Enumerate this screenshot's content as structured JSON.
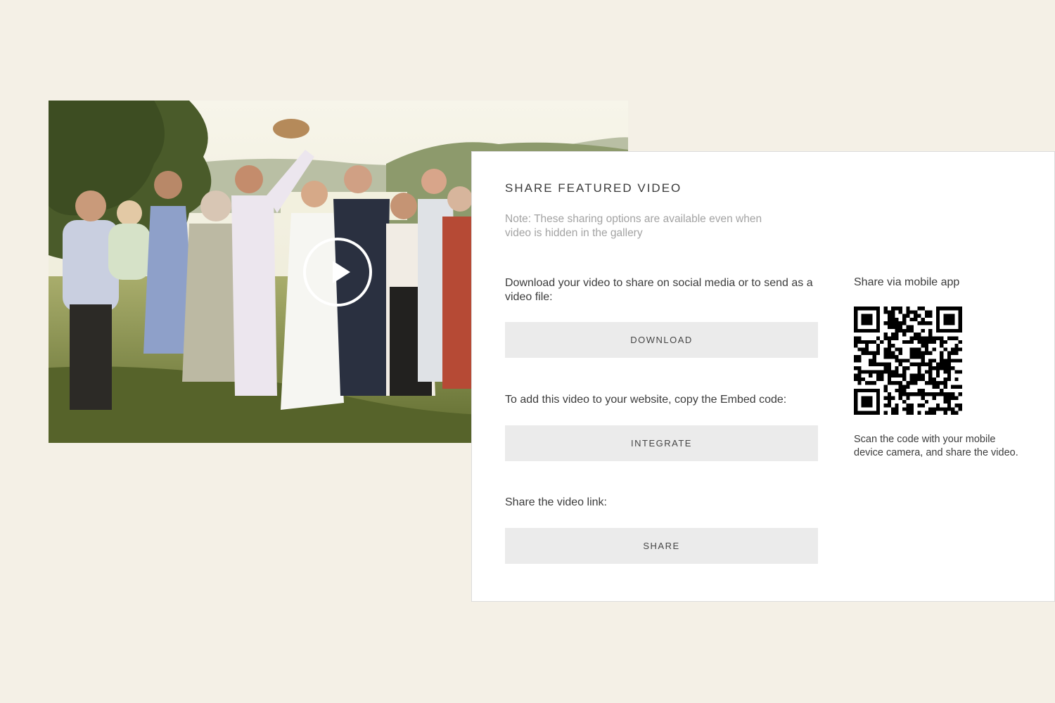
{
  "video": {
    "play_icon": "play-icon"
  },
  "share_panel": {
    "title": "SHARE FEATURED VIDEO",
    "note": "Note: These sharing options are available even when video is hidden in the gallery",
    "download": {
      "description": "Download your video to share on social media or to send as a video file:",
      "button_label": "DOWNLOAD"
    },
    "integrate": {
      "description": "To add this video to your website, copy the Embed code:",
      "button_label": "INTEGRATE"
    },
    "share": {
      "description": "Share the video link:",
      "button_label": "SHARE"
    },
    "mobile": {
      "title": "Share via mobile app",
      "description": "Scan the code with your mobile device camera, and share the video."
    }
  },
  "colors": {
    "page_background": "#f4f0e6",
    "panel_background": "#ffffff",
    "button_background": "#ebebeb",
    "note_text": "#a3a3a3"
  }
}
